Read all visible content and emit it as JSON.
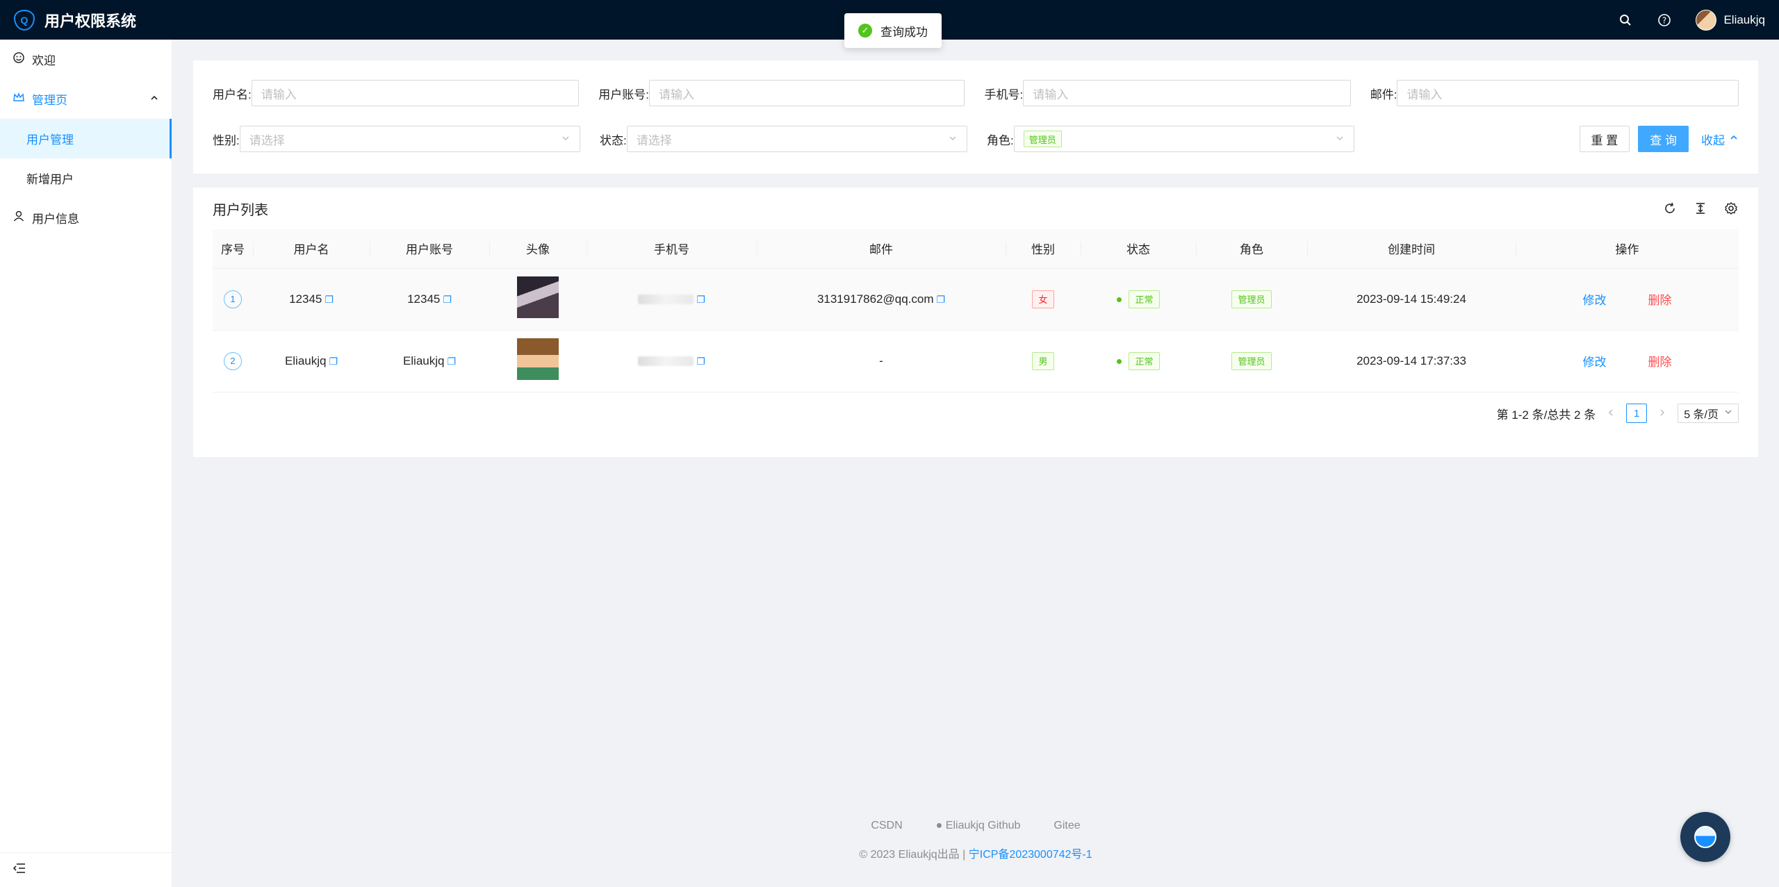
{
  "app": {
    "title": "用户权限系统",
    "logo_letter": "Q"
  },
  "header": {
    "username": "Eliaukjq"
  },
  "toast": {
    "message": "查询成功"
  },
  "sidebar": {
    "welcome": "欢迎",
    "admin": "管理页",
    "sub_items": [
      "用户管理",
      "新增用户"
    ],
    "user_info": "用户信息"
  },
  "search": {
    "username_label": "用户名:",
    "account_label": "用户账号:",
    "phone_label": "手机号:",
    "email_label": "邮件:",
    "gender_label": "性别:",
    "status_label": "状态:",
    "role_label": "角色:",
    "input_placeholder": "请输入",
    "select_placeholder": "请选择",
    "role_value": "管理员",
    "reset": "重 置",
    "query": "查 询",
    "collapse": "收起"
  },
  "table": {
    "title": "用户列表",
    "columns": [
      "序号",
      "用户名",
      "用户账号",
      "头像",
      "手机号",
      "邮件",
      "性别",
      "状态",
      "角色",
      "创建时间",
      "操作"
    ],
    "rows": [
      {
        "index": "1",
        "username": "12345",
        "account": "12345",
        "email": "3131917862@qq.com",
        "gender": "女",
        "status": "正常",
        "role": "管理员",
        "created": "2023-09-14 15:49:24",
        "edit": "修改",
        "delete": "删除"
      },
      {
        "index": "2",
        "username": "Eliaukjq",
        "account": "Eliaukjq",
        "email": "-",
        "gender": "男",
        "status": "正常",
        "role": "管理员",
        "created": "2023-09-14 17:37:33",
        "edit": "修改",
        "delete": "删除"
      }
    ]
  },
  "pagination": {
    "summary": "第 1-2 条/总共 2 条",
    "current": "1",
    "page_size": "5 条/页"
  },
  "footer": {
    "links": [
      "CSDN",
      "Eliaukjq Github",
      "Gitee"
    ],
    "copyright": "2023 Eliaukjq出品 |",
    "icp": "宁ICP备2023000742号-1"
  },
  "colors": {
    "header_bg": "#001529",
    "accent": "#1890ff",
    "success": "#52c41a",
    "danger": "#ff4d4f"
  }
}
